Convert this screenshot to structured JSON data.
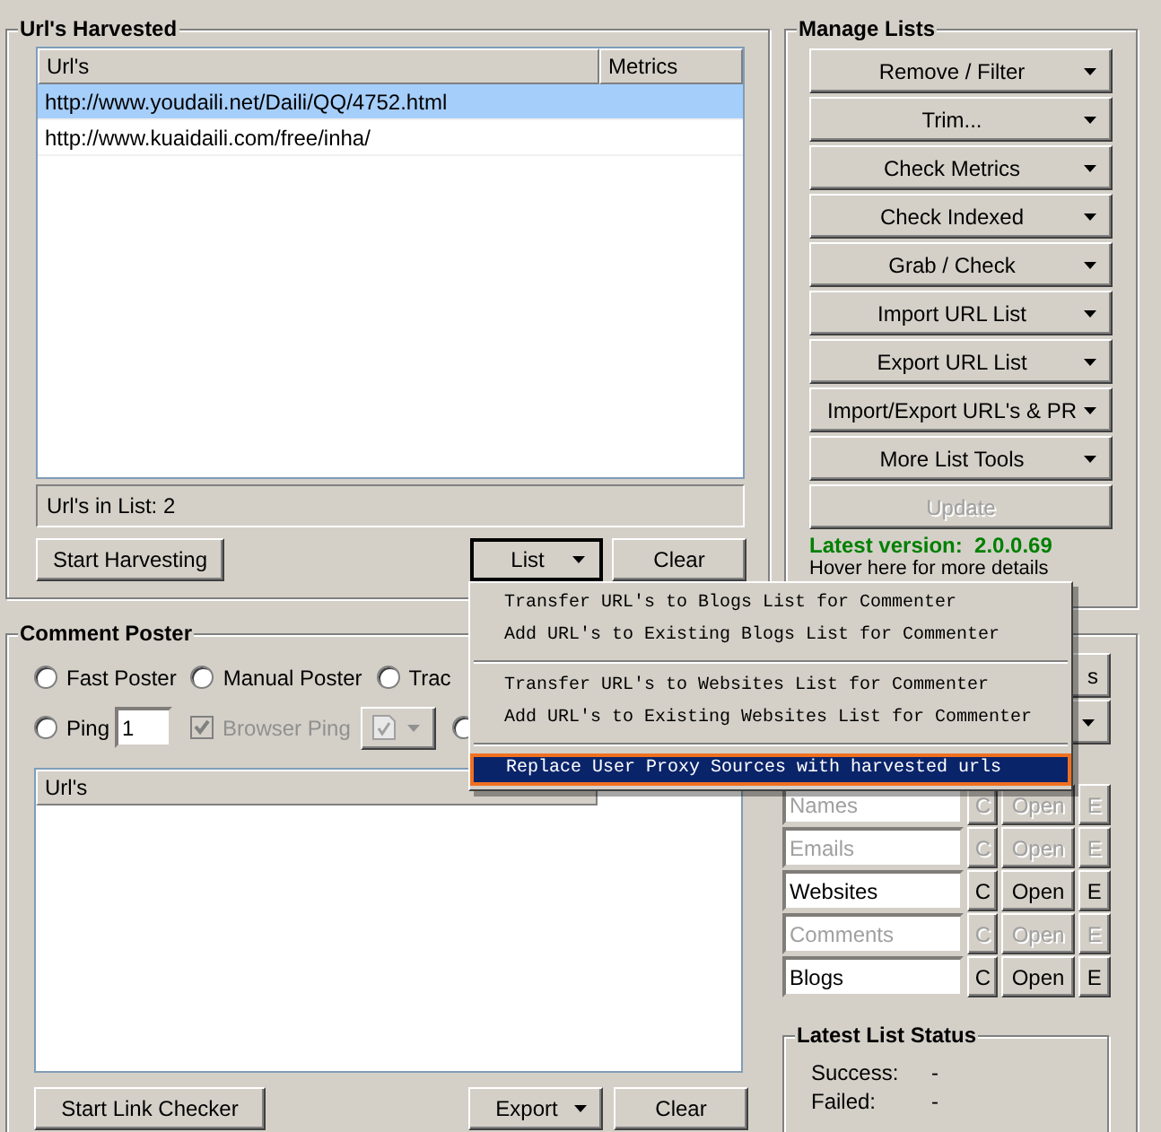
{
  "harvested": {
    "title": "Url's Harvested",
    "columns": [
      "Url's",
      "Metrics"
    ],
    "rows": [
      {
        "url": "http://www.youdaili.net/Daili/QQ/4752.html",
        "selected": true
      },
      {
        "url": "http://www.kuaidaili.com/free/inha/",
        "selected": false
      }
    ],
    "count_label": "Url's in List: 2",
    "buttons": [
      {
        "label": "Start Harvesting",
        "kind": "plain",
        "pressed": false
      },
      {
        "label": "List",
        "kind": "dropdown",
        "pressed": true
      },
      {
        "label": "Clear",
        "kind": "plain",
        "pressed": false
      }
    ]
  },
  "manage_lists": {
    "title": "Manage Lists",
    "buttons": [
      {
        "label": "Remove / Filter",
        "kind": "dropdown",
        "disabled": false
      },
      {
        "label": "Trim...",
        "kind": "dropdown",
        "disabled": false
      },
      {
        "label": "Check Metrics",
        "kind": "dropdown",
        "disabled": false
      },
      {
        "label": "Check Indexed",
        "kind": "dropdown",
        "disabled": false
      },
      {
        "label": "Grab / Check",
        "kind": "dropdown",
        "disabled": false
      },
      {
        "label": "Import URL List",
        "kind": "dropdown",
        "disabled": false
      },
      {
        "label": "Export URL List",
        "kind": "dropdown",
        "disabled": false
      },
      {
        "label": "Import/Export URL's & PR",
        "kind": "dropdown",
        "disabled": false
      },
      {
        "label": "More List Tools",
        "kind": "dropdown",
        "disabled": false
      },
      {
        "label": "Update",
        "kind": "plain",
        "disabled": true
      }
    ],
    "version_text": "Latest version:  2.0.0.69",
    "hover_text": "Hover here for more details"
  },
  "comment_poster": {
    "title": "Comment Poster",
    "modes": [
      {
        "label": "Fast Poster",
        "selected": false
      },
      {
        "label": "Manual Poster",
        "selected": false
      },
      {
        "label": "Trac",
        "selected": false
      }
    ],
    "ping": {
      "label": "Ping",
      "selected": false,
      "value": "1"
    },
    "browser_ping": {
      "label": "Browser Ping",
      "checked": true,
      "disabled": true
    },
    "option_radio": {
      "selected": false
    },
    "side_button": {
      "label": "s"
    },
    "columns": [
      "Url's"
    ],
    "lists": [
      {
        "name": "Names",
        "enabled": false,
        "buttons": [
          "C",
          "Open",
          "E"
        ]
      },
      {
        "name": "Emails",
        "enabled": false,
        "buttons": [
          "C",
          "Open",
          "E"
        ]
      },
      {
        "name": "Websites",
        "enabled": true,
        "buttons": [
          "C",
          "Open",
          "E"
        ]
      },
      {
        "name": "Comments",
        "enabled": false,
        "buttons": [
          "C",
          "Open",
          "E"
        ]
      },
      {
        "name": "Blogs",
        "enabled": true,
        "buttons": [
          "C",
          "Open",
          "E"
        ]
      }
    ],
    "buttons": [
      {
        "label": "Start Link Checker",
        "kind": "plain"
      },
      {
        "label": "Export",
        "kind": "dropdown"
      },
      {
        "label": "Clear",
        "kind": "plain"
      }
    ],
    "status": {
      "title": "Latest List Status",
      "rows": [
        {
          "label": "Success:",
          "value": "-"
        },
        {
          "label": "Failed:",
          "value": "-"
        }
      ]
    }
  },
  "menu": {
    "groups": [
      [
        {
          "label": "Transfer URL's to Blogs List for Commenter",
          "selected": false
        },
        {
          "label": "Add URL's to Existing Blogs List for Commenter",
          "selected": false
        }
      ],
      [
        {
          "label": "Transfer URL's to Websites List for Commenter",
          "selected": false
        },
        {
          "label": "Add URL's to Existing Websites List for Commenter",
          "selected": false
        }
      ],
      [
        {
          "label": "Replace User Proxy Sources with harvested urls",
          "selected": true
        }
      ]
    ]
  }
}
